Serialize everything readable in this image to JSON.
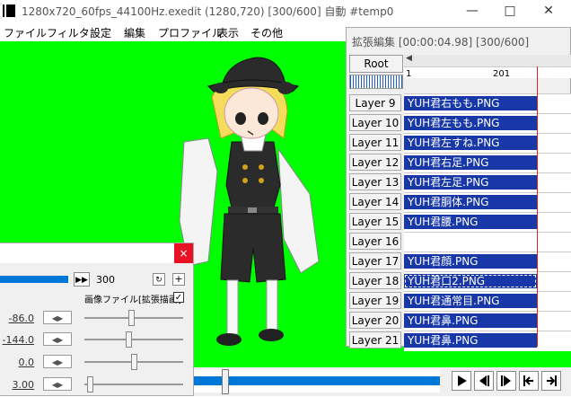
{
  "window": {
    "title": "1280x720_60fps_44100Hz.exedit (1280,720)  [300/600]  自動  #temp0",
    "controls": [
      "minimize-icon",
      "maximize-icon",
      "close-icon"
    ]
  },
  "menubar": {
    "items": [
      "ファイル",
      "フィルタ",
      "設定",
      "編集",
      "プロファイル",
      "表示",
      "その他"
    ]
  },
  "extended_editor": {
    "title": "拡張編集 [00:00:04.98] [300/600]",
    "root_label": "Root",
    "ruler_labels": [
      "1",
      "201"
    ],
    "layers": [
      {
        "label": "Layer 9",
        "clip": "YUH君右もも.PNG",
        "selected": false
      },
      {
        "label": "Layer 10",
        "clip": "YUH君左もも.PNG",
        "selected": false
      },
      {
        "label": "Layer 11",
        "clip": "YUH君左すね.PNG",
        "selected": false
      },
      {
        "label": "Layer 12",
        "clip": "YUH君右足.PNG",
        "selected": false
      },
      {
        "label": "Layer 13",
        "clip": "YUH君左足.PNG",
        "selected": false
      },
      {
        "label": "Layer 14",
        "clip": "YUH君胴体.PNG",
        "selected": false
      },
      {
        "label": "Layer 15",
        "clip": "YUH君腰.PNG",
        "selected": false
      },
      {
        "label": "Layer 16",
        "clip": "",
        "selected": false
      },
      {
        "label": "Layer 17",
        "clip": "YUH君顔.PNG",
        "selected": false
      },
      {
        "label": "Layer 18",
        "clip": "YUH君口2.PNG",
        "selected": true
      },
      {
        "label": "Layer 19",
        "clip": "YUH君通常目.PNG",
        "selected": false
      },
      {
        "label": "Layer 20",
        "clip": "YUH君鼻.PNG",
        "selected": false
      },
      {
        "label": "Layer 21",
        "clip": "YUH君鼻.PNG",
        "selected": false
      }
    ]
  },
  "properties": {
    "close_label": "×",
    "frame_value": "300",
    "filter_label": "画像ファイル[拡張描画]",
    "filter_checked": "✓",
    "rows": [
      {
        "value": "-86.0",
        "level": 0.48
      },
      {
        "value": "-144.0",
        "level": 0.45
      },
      {
        "value": "0.0",
        "level": 0.5
      },
      {
        "value": "3.00",
        "level": 0.03
      }
    ]
  },
  "colors": {
    "canvas": "#00ff00",
    "clip": "#1838a8",
    "accent": "#0078d7",
    "cursor": "#e02020"
  }
}
